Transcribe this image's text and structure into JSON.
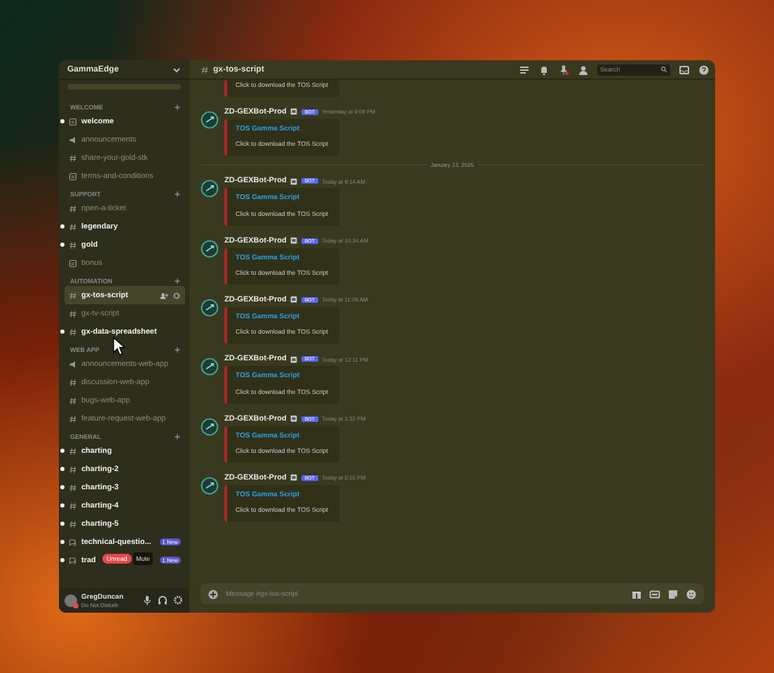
{
  "server": {
    "name": "GammaEdge"
  },
  "categories": [
    {
      "name": "WELCOME",
      "channels": [
        {
          "name": "welcome",
          "kind": "rules",
          "unread": true,
          "selected": false
        },
        {
          "name": "announcements",
          "kind": "announcement",
          "unread": false,
          "selected": false
        },
        {
          "name": "share-your-gold-stk",
          "kind": "text",
          "unread": false,
          "selected": false
        },
        {
          "name": "terms-and-conditions",
          "kind": "rules",
          "unread": false,
          "selected": false
        }
      ]
    },
    {
      "name": "SUPPORT",
      "channels": [
        {
          "name": "open-a-ticket",
          "kind": "text",
          "unread": false,
          "selected": false
        },
        {
          "name": "legendary",
          "kind": "text",
          "unread": true,
          "selected": false
        },
        {
          "name": "gold",
          "kind": "text",
          "unread": true,
          "selected": false
        },
        {
          "name": "bonus",
          "kind": "rules",
          "unread": false,
          "selected": false
        }
      ]
    },
    {
      "name": "AUTOMATION",
      "channels": [
        {
          "name": "gx-tos-script",
          "kind": "text",
          "unread": false,
          "selected": true
        },
        {
          "name": "gx-tv-script",
          "kind": "text",
          "unread": false,
          "selected": false
        },
        {
          "name": "gx-data-spreadsheet",
          "kind": "text",
          "unread": true,
          "selected": false
        }
      ]
    },
    {
      "name": "WEB APP",
      "channels": [
        {
          "name": "announcements-web-app",
          "kind": "announcement",
          "unread": false,
          "selected": false
        },
        {
          "name": "discussion-web-app",
          "kind": "text",
          "unread": false,
          "selected": false
        },
        {
          "name": "bugs-web-app",
          "kind": "text",
          "unread": false,
          "selected": false
        },
        {
          "name": "feature-request-web-app",
          "kind": "text",
          "unread": false,
          "selected": false
        }
      ]
    },
    {
      "name": "GENERAL",
      "channels": [
        {
          "name": "charting",
          "kind": "text",
          "unread": true,
          "selected": false
        },
        {
          "name": "charting-2",
          "kind": "text",
          "unread": true,
          "selected": false
        },
        {
          "name": "charting-3",
          "kind": "text",
          "unread": true,
          "selected": false
        },
        {
          "name": "charting-4",
          "kind": "text",
          "unread": true,
          "selected": false
        },
        {
          "name": "charting-5",
          "kind": "text",
          "unread": true,
          "selected": false
        },
        {
          "name": "technical-questio...",
          "kind": "forum",
          "unread": true,
          "selected": false,
          "badge": "1 New"
        },
        {
          "name": "trad",
          "kind": "forum",
          "unread": true,
          "selected": false,
          "badge": "1 New"
        }
      ]
    }
  ],
  "hover_pill": "Unread",
  "tooltip": "Mute",
  "user": {
    "name": "GregDuncan",
    "status": "Do Not Disturb"
  },
  "header": {
    "channel": "gx-tos-script",
    "search_placeholder": "Search"
  },
  "top_embed": {
    "text": "Click to download the TOS Script"
  },
  "feed": [
    {
      "kind": "message",
      "author": "ZD-GEXBot-Prod",
      "tag": "BOT",
      "time": "Yesterday at 9:09 PM",
      "embed_title": "TOS Gamma Script",
      "embed_text": "Click to download the TOS Script"
    },
    {
      "kind": "divider",
      "label": "January 13, 2025"
    },
    {
      "kind": "message",
      "author": "ZD-GEXBot-Prod",
      "tag": "BOT",
      "time": "Today at 9:14 AM",
      "embed_title": "TOS Gamma Script",
      "embed_text": "Click to download the TOS Script"
    },
    {
      "kind": "message",
      "author": "ZD-GEXBot-Prod",
      "tag": "BOT",
      "time": "Today at 10:34 AM",
      "embed_title": "TOS Gamma Script",
      "embed_text": "Click to download the TOS Script"
    },
    {
      "kind": "message",
      "author": "ZD-GEXBot-Prod",
      "tag": "BOT",
      "time": "Today at 11:09 AM",
      "embed_title": "TOS Gamma Script",
      "embed_text": "Click to download the TOS Script"
    },
    {
      "kind": "message",
      "author": "ZD-GEXBot-Prod",
      "tag": "BOT",
      "time": "Today at 12:11 PM",
      "embed_title": "TOS Gamma Script",
      "embed_text": "Click to download the TOS Script"
    },
    {
      "kind": "message",
      "author": "ZD-GEXBot-Prod",
      "tag": "BOT",
      "time": "Today at 1:32 PM",
      "embed_title": "TOS Gamma Script",
      "embed_text": "Click to download the TOS Script"
    },
    {
      "kind": "message",
      "author": "ZD-GEXBot-Prod",
      "tag": "BOT",
      "time": "Today at 2:15 PM",
      "embed_title": "TOS Gamma Script",
      "embed_text": "Click to download the TOS Script"
    }
  ],
  "composer": {
    "placeholder": "Message #gx-tos-script"
  }
}
